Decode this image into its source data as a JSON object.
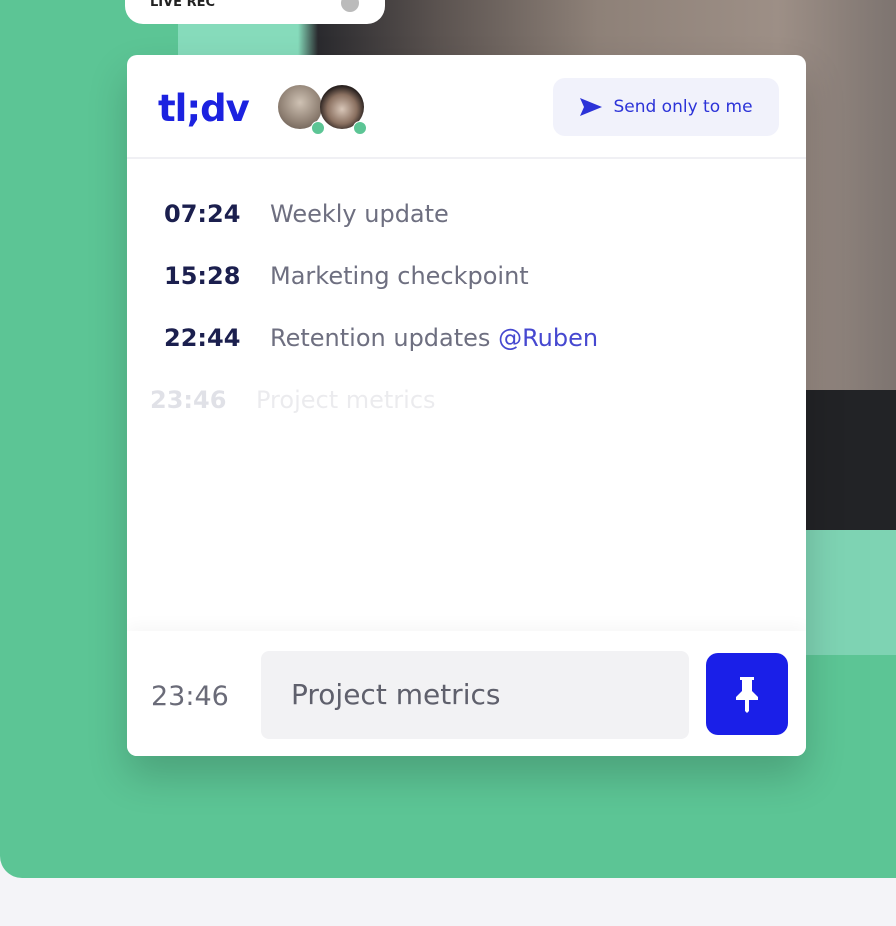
{
  "live_card": {
    "label": "LIVE REC"
  },
  "header": {
    "logo": "tl;dv",
    "send_button": "Send only to me"
  },
  "notes": [
    {
      "time": "07:24",
      "text": "Weekly update",
      "mention": ""
    },
    {
      "time": "15:28",
      "text": "Marketing checkpoint",
      "mention": ""
    },
    {
      "time": "22:44",
      "text": "Retention updates",
      "mention": "@Ruben"
    },
    {
      "time": "23:46",
      "text": "Project metrics",
      "mention": ""
    }
  ],
  "composer": {
    "time": "23:46",
    "value": "Project metrics"
  },
  "colors": {
    "brand": "#1c22e0",
    "background": "#5cc595"
  }
}
